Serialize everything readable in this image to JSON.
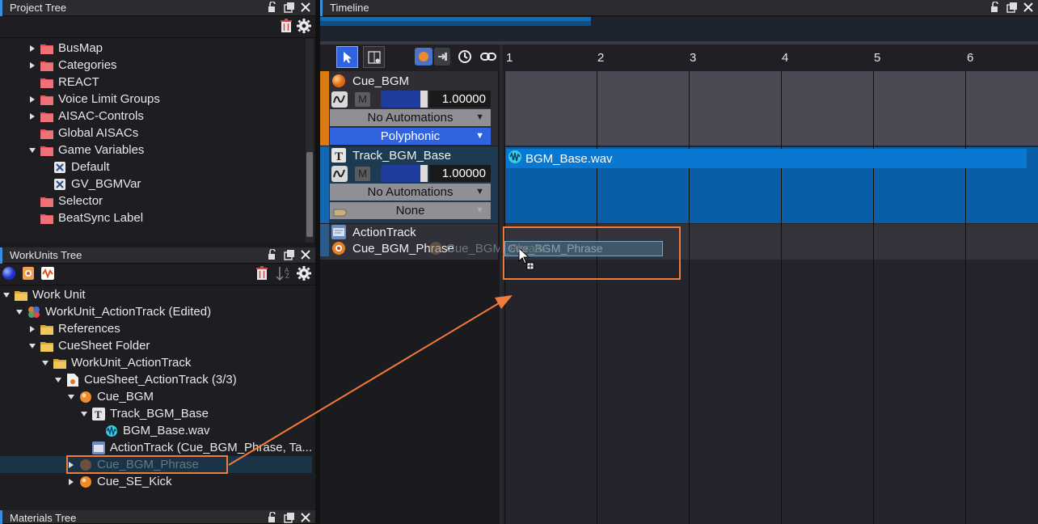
{
  "project_tree": {
    "title": "Project Tree",
    "items": [
      {
        "label": "BusMap",
        "icon": "folder-red-icon",
        "expand": true
      },
      {
        "label": "Categories",
        "icon": "folder-red-icon",
        "expand": true
      },
      {
        "label": "REACT",
        "icon": "folder-red-icon",
        "expand": false
      },
      {
        "label": "Voice Limit Groups",
        "icon": "folder-red-icon",
        "expand": true
      },
      {
        "label": "AISAC-Controls",
        "icon": "folder-red-icon",
        "expand": true
      },
      {
        "label": "Global AISACs",
        "icon": "folder-red-icon",
        "expand": false
      },
      {
        "label": "Game Variables",
        "icon": "folder-red-icon",
        "expand": "open"
      },
      {
        "label": "Default",
        "icon": "variable-icon",
        "expand": false
      },
      {
        "label": "GV_BGMVar",
        "icon": "variable-icon",
        "expand": false
      },
      {
        "label": "Selector",
        "icon": "folder-red-icon",
        "expand": false
      },
      {
        "label": "BeatSync Label",
        "icon": "folder-red-icon",
        "expand": false
      }
    ]
  },
  "workunits_tree": {
    "title": "WorkUnits Tree",
    "sort_label": "Z",
    "items": [
      {
        "label": "Work Unit",
        "icon": "folder-yellow-icon",
        "expand": "open",
        "indent": 0
      },
      {
        "label": "WorkUnit_ActionTrack (Edited)",
        "icon": "workunit-icon",
        "expand": "open",
        "indent": 1
      },
      {
        "label": "References",
        "icon": "folder-yellow-icon",
        "expand": true,
        "indent": 2
      },
      {
        "label": "CueSheet Folder",
        "icon": "folder-yellow-icon",
        "expand": "open",
        "indent": 2
      },
      {
        "label": "WorkUnit_ActionTrack",
        "icon": "folder-yellow-icon",
        "expand": "open",
        "indent": 3
      },
      {
        "label": "CueSheet_ActionTrack (3/3)",
        "icon": "cuesheet-icon",
        "expand": "open",
        "indent": 4
      },
      {
        "label": "Cue_BGM",
        "icon": "cue-icon",
        "expand": "open",
        "indent": 5
      },
      {
        "label": "Track_BGM_Base",
        "icon": "track-icon",
        "expand": "open",
        "indent": 6
      },
      {
        "label": "BGM_Base.wav",
        "icon": "waveform-icon",
        "expand": false,
        "indent": 7
      },
      {
        "label": "ActionTrack (Cue_BGM_Phrase, Ta...",
        "icon": "actiontrack-icon",
        "expand": false,
        "indent": 6
      },
      {
        "label": "Cue_BGM_Phrase",
        "icon": "cue-dim-icon",
        "expand": true,
        "indent": 5,
        "selected": true
      },
      {
        "label": "Cue_SE_Kick",
        "icon": "cue-icon",
        "expand": true,
        "indent": 5
      }
    ]
  },
  "materials_tree": {
    "title": "Materials Tree"
  },
  "timeline": {
    "title": "Timeline",
    "ruler": [
      "1",
      "2",
      "3",
      "4",
      "5",
      "6"
    ],
    "tracks": {
      "cue": {
        "name": "Cue_BGM",
        "mute_label": "M",
        "value": "1.00000",
        "automation": "No Automations",
        "mode": "Polyphonic"
      },
      "track": {
        "name": "Track_BGM_Base",
        "mute_label": "M",
        "value": "1.00000",
        "automation": "No Automations",
        "select": "None",
        "clip": "BGM_Base.wav"
      },
      "action": {
        "name": "ActionTrack",
        "cue_ref": "Cue_BGM_Phrase",
        "drag_ghost": "Cue_BGM_Phrase",
        "drag_clip": "Cue_BGM_Phrase"
      }
    }
  },
  "colors": {
    "accent": "#3a8ee0",
    "clip_blue": "#0a78d0",
    "annotation_orange": "#f07b3a",
    "polyphonic_blue": "#2f63e0"
  }
}
